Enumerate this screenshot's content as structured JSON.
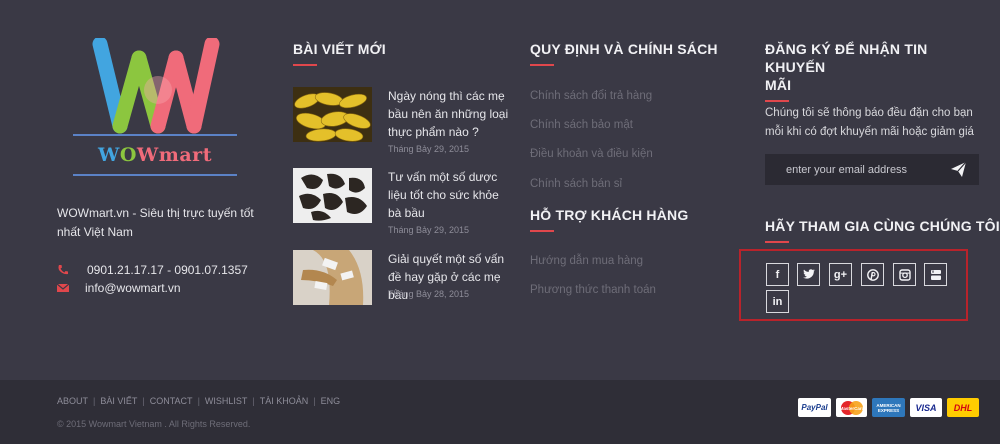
{
  "brand": {
    "w1": "W",
    "o": "O",
    "w2": "W",
    "rest": "mart"
  },
  "about": {
    "tagline": "WOWmart.vn - Siêu thị trực tuyến tốt nhất Việt Nam",
    "phone": "0901.21.17.17 - 0901.07.1357",
    "email": "info@wowmart.vn"
  },
  "blog": {
    "heading": "BÀI VIẾT MỚI",
    "posts": [
      {
        "title": "Ngày nóng thì các mẹ bầu nên ăn những loại thực phẩm nào ?",
        "date": "Tháng Bảy 29, 2015"
      },
      {
        "title": "Tư vấn một số dược liệu tốt cho sức khỏe bà bầu",
        "date": "Tháng Bảy 29, 2015"
      },
      {
        "title": "Giải quyết một số vấn đề hay gặp ở các mẹ bầu",
        "date": "Tháng Bảy 28, 2015"
      }
    ]
  },
  "policy": {
    "heading": "QUY ĐỊNH VÀ CHÍNH SÁCH",
    "links": [
      "Chính sách đổi trả hàng",
      "Chính sách bảo mật",
      "Điều khoản và điều kiện",
      "Chính sách bán sỉ"
    ]
  },
  "support": {
    "heading": "HỖ TRỢ KHÁCH HÀNG",
    "links": [
      "Hướng dẫn mua hàng",
      "Phương thức thanh toán"
    ]
  },
  "newsletter": {
    "heading_line1": "ĐĂNG KÝ ĐỂ NHẬN TIN KHUYẾN",
    "heading_line2": "MÃI",
    "text": "Chúng tôi sẽ thông báo đều đặn cho bạn mỗi khi có đợt khuyến mãi hoặc giảm giá",
    "placeholder": "enter your email address"
  },
  "social": {
    "heading": "HÃY THAM GIA CÙNG CHÚNG TÔI",
    "icons": [
      "facebook-icon",
      "twitter-icon",
      "google-plus-icon",
      "pinterest-icon",
      "instagram-icon",
      "youtube-icon",
      "linkedin-icon"
    ],
    "glyphs": {
      "facebook": "f",
      "google": "g+",
      "linkedin": "in"
    }
  },
  "bottom": {
    "nav": [
      "ABOUT",
      "BÀI VIẾT",
      "CONTACT",
      "WISHLIST",
      "TÀI KHOẢN",
      "ENG"
    ],
    "separator": "|",
    "copyright": "© 2015 Wowmart Vietnam . All Rights Reserved."
  },
  "payments": {
    "paypal": "PayPal",
    "mastercard": "MasterCard",
    "amex": "AMERICAN EXPRESS",
    "visa": "VISA",
    "dhl": "DHL"
  },
  "colors": {
    "accent": "#e0474c",
    "background": "#3a3945",
    "bottom_bar": "#2f2e37",
    "highlight_border": "#b8232b"
  }
}
